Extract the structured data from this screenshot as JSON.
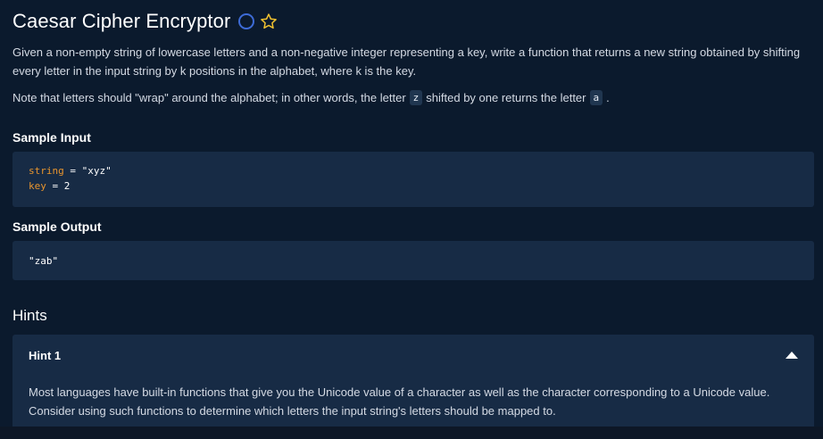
{
  "problem": {
    "title": "Caesar Cipher Encryptor",
    "description": "Given a non-empty string of lowercase letters and a non-negative integer representing a key, write a function that returns a new string obtained by shifting every letter in the input string by k positions in the alphabet, where k is the key.",
    "note_before_z": "Note that letters should \"wrap\" around the alphabet; in other words, the letter",
    "note_z": "z",
    "note_middle": "shifted by one returns the letter",
    "note_a": "a",
    "note_end": "."
  },
  "sample_input": {
    "label": "Sample Input",
    "line1_var": "string",
    "line1_rest": " = \"xyz\"",
    "line2_var": "key",
    "line2_rest": " = 2"
  },
  "sample_output": {
    "label": "Sample Output",
    "value": "\"zab\""
  },
  "hints": {
    "title": "Hints",
    "items": [
      {
        "label": "Hint 1",
        "text": "Most languages have built-in functions that give you the Unicode value of a character as well as the character corresponding to a Unicode value. Consider using such functions to determine which letters the input string's letters should be mapped to."
      }
    ]
  },
  "colors": {
    "background": "#0b1a2d",
    "panel": "#172b45",
    "accent_blue": "#3d6bd6",
    "star_yellow": "#f2c230",
    "code_var_orange": "#e8952e"
  },
  "icons": [
    "status-circle-icon",
    "star-icon",
    "caret-up-icon"
  ]
}
